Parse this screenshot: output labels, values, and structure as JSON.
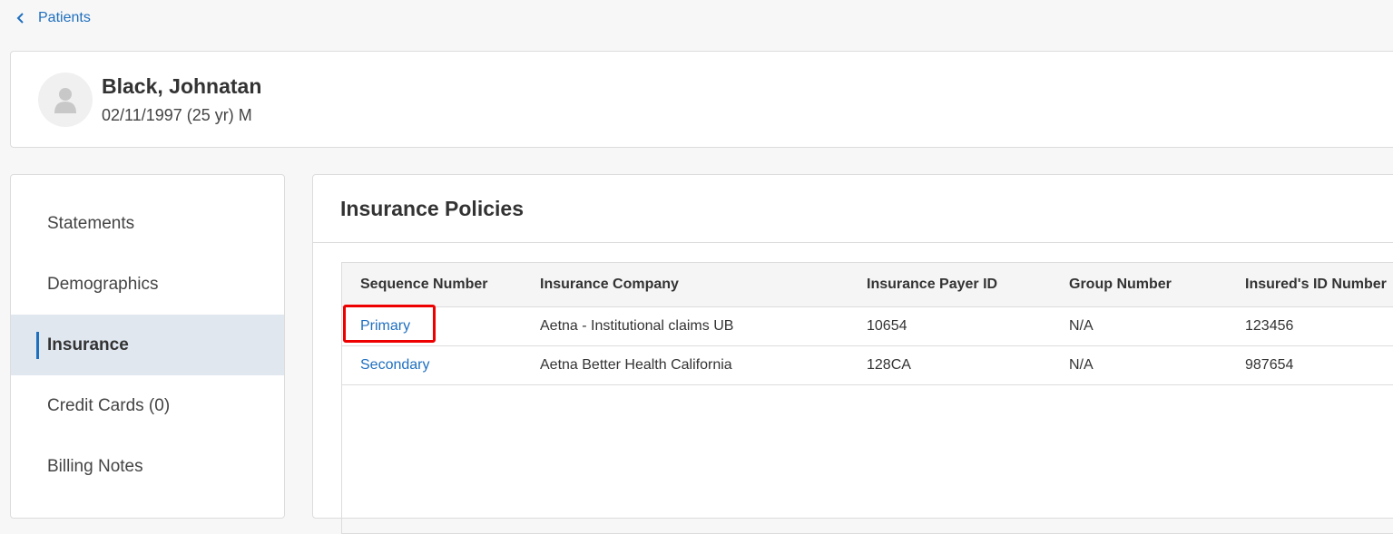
{
  "nav": {
    "back_label": "Patients"
  },
  "patient": {
    "name": "Black, Johnatan",
    "details": "02/11/1997 (25 yr) M"
  },
  "sidebar": {
    "items": [
      {
        "label": "Statements",
        "active": false
      },
      {
        "label": "Demographics",
        "active": false
      },
      {
        "label": "Insurance",
        "active": true
      },
      {
        "label": "Credit Cards (0)",
        "active": false
      },
      {
        "label": "Billing Notes",
        "active": false
      }
    ]
  },
  "insurance": {
    "title": "Insurance Policies",
    "columns": [
      "Sequence Number",
      "Insurance Company",
      "Insurance Payer ID",
      "Group Number",
      "Insured's ID Number"
    ],
    "rows": [
      {
        "sequence": "Primary",
        "company": "Aetna - Institutional claims UB",
        "payer_id": "10654",
        "group": "N/A",
        "insured_id": "123456"
      },
      {
        "sequence": "Secondary",
        "company": "Aetna Better Health California",
        "payer_id": "128CA",
        "group": "N/A",
        "insured_id": "987654"
      }
    ]
  },
  "colors": {
    "accent": "#1f6fbf",
    "highlight": "#ee0000",
    "active_bg": "#e1e7ef"
  }
}
